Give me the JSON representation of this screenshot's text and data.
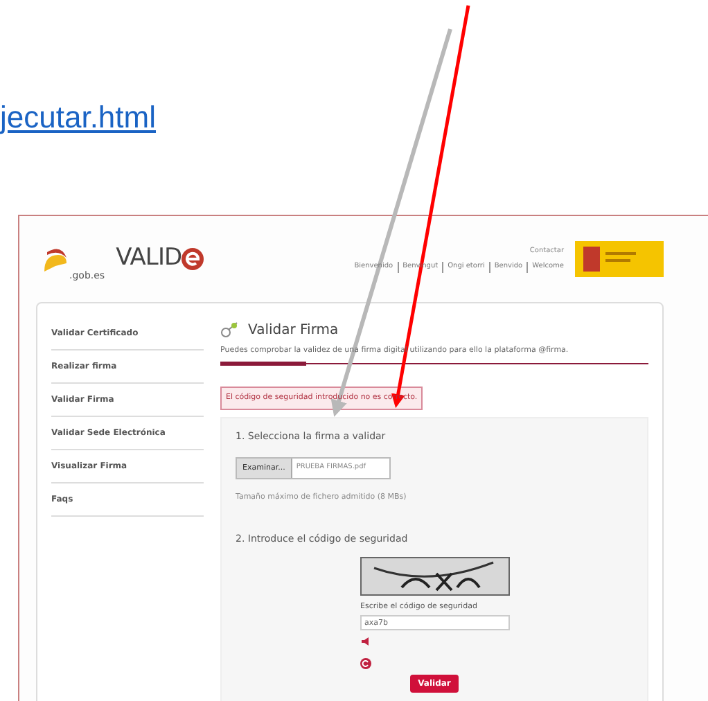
{
  "document_link": "jecutar.html",
  "header": {
    "logo_text": ".gob.es",
    "brand": "VALID",
    "contact": "Contactar",
    "languages": [
      "Bienvenido",
      "Benvingut",
      "Ongi etorri",
      "Benvido",
      "Welcome"
    ]
  },
  "sidebar": {
    "items": [
      "Validar Certificado",
      "Realizar firma",
      "Validar Firma",
      "Validar Sede Electrónica",
      "Visualizar Firma",
      "Faqs"
    ]
  },
  "main": {
    "title": "Validar Firma",
    "description": "Puedes comprobar la validez de una firma digital utilizando para ello la plataforma @firma.",
    "progress": {
      "level": 0.2
    },
    "error": "El código de seguridad introducido no es correcto.",
    "step1": "1. Selecciona la firma a validar",
    "browse_button": "Examinar...",
    "file_name": "PRUEBA FIRMAS.pdf",
    "hint": "Tamaño máximo de fichero admitido (8 MBs)",
    "step2": "2. Introduce el código de seguridad",
    "captcha_label": "Escribe el código de seguridad",
    "captcha_value": "axa7b",
    "submit": "Validar"
  }
}
